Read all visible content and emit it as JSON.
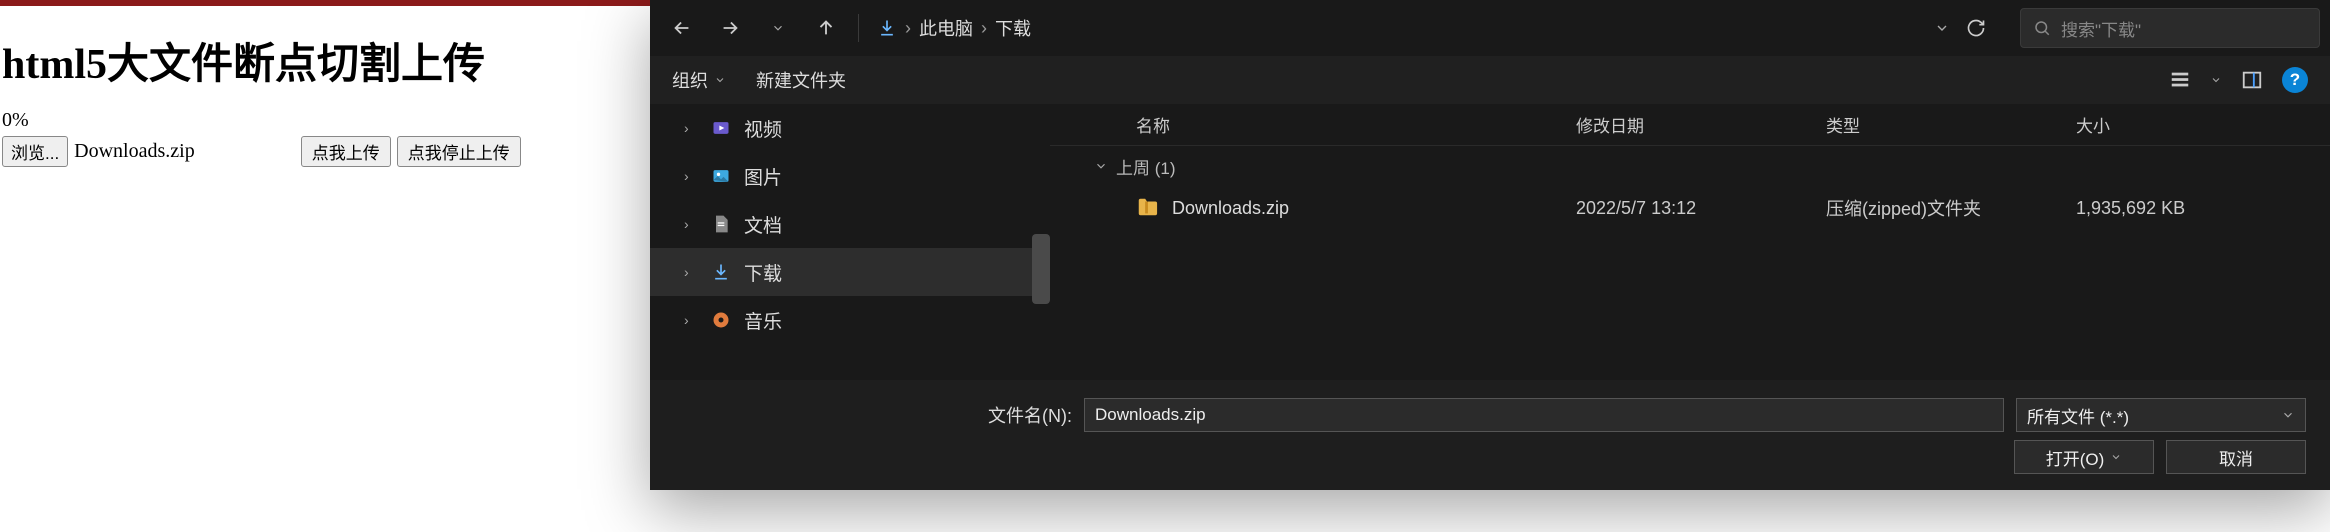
{
  "page": {
    "title": "html5大文件断点切割上传",
    "progress_text": "0%",
    "browse_label": "浏览...",
    "selected_file": "Downloads.zip",
    "upload_label": "点我上传",
    "stop_label": "点我停止上传"
  },
  "dialog": {
    "nav": {
      "breadcrumb": [
        "此电脑",
        "下载"
      ],
      "search_placeholder": "搜索\"下载\""
    },
    "toolbar": {
      "organize": "组织",
      "new_folder": "新建文件夹"
    },
    "sidebar": {
      "items": [
        {
          "label": "视频",
          "icon": "video"
        },
        {
          "label": "图片",
          "icon": "image"
        },
        {
          "label": "文档",
          "icon": "doc"
        },
        {
          "label": "下载",
          "icon": "download",
          "selected": true
        },
        {
          "label": "音乐",
          "icon": "music"
        }
      ]
    },
    "columns": {
      "name": "名称",
      "date": "修改日期",
      "type": "类型",
      "size": "大小"
    },
    "group_label": "上周 (1)",
    "files": [
      {
        "name": "Downloads.zip",
        "date": "2022/5/7 13:12",
        "type": "压缩(zipped)文件夹",
        "size": "1,935,692 KB"
      }
    ],
    "filename_label": "文件名(N):",
    "filename_value": "Downloads.zip",
    "filter_value": "所有文件 (*.*)",
    "open_label": "打开(O)",
    "cancel_label": "取消"
  }
}
